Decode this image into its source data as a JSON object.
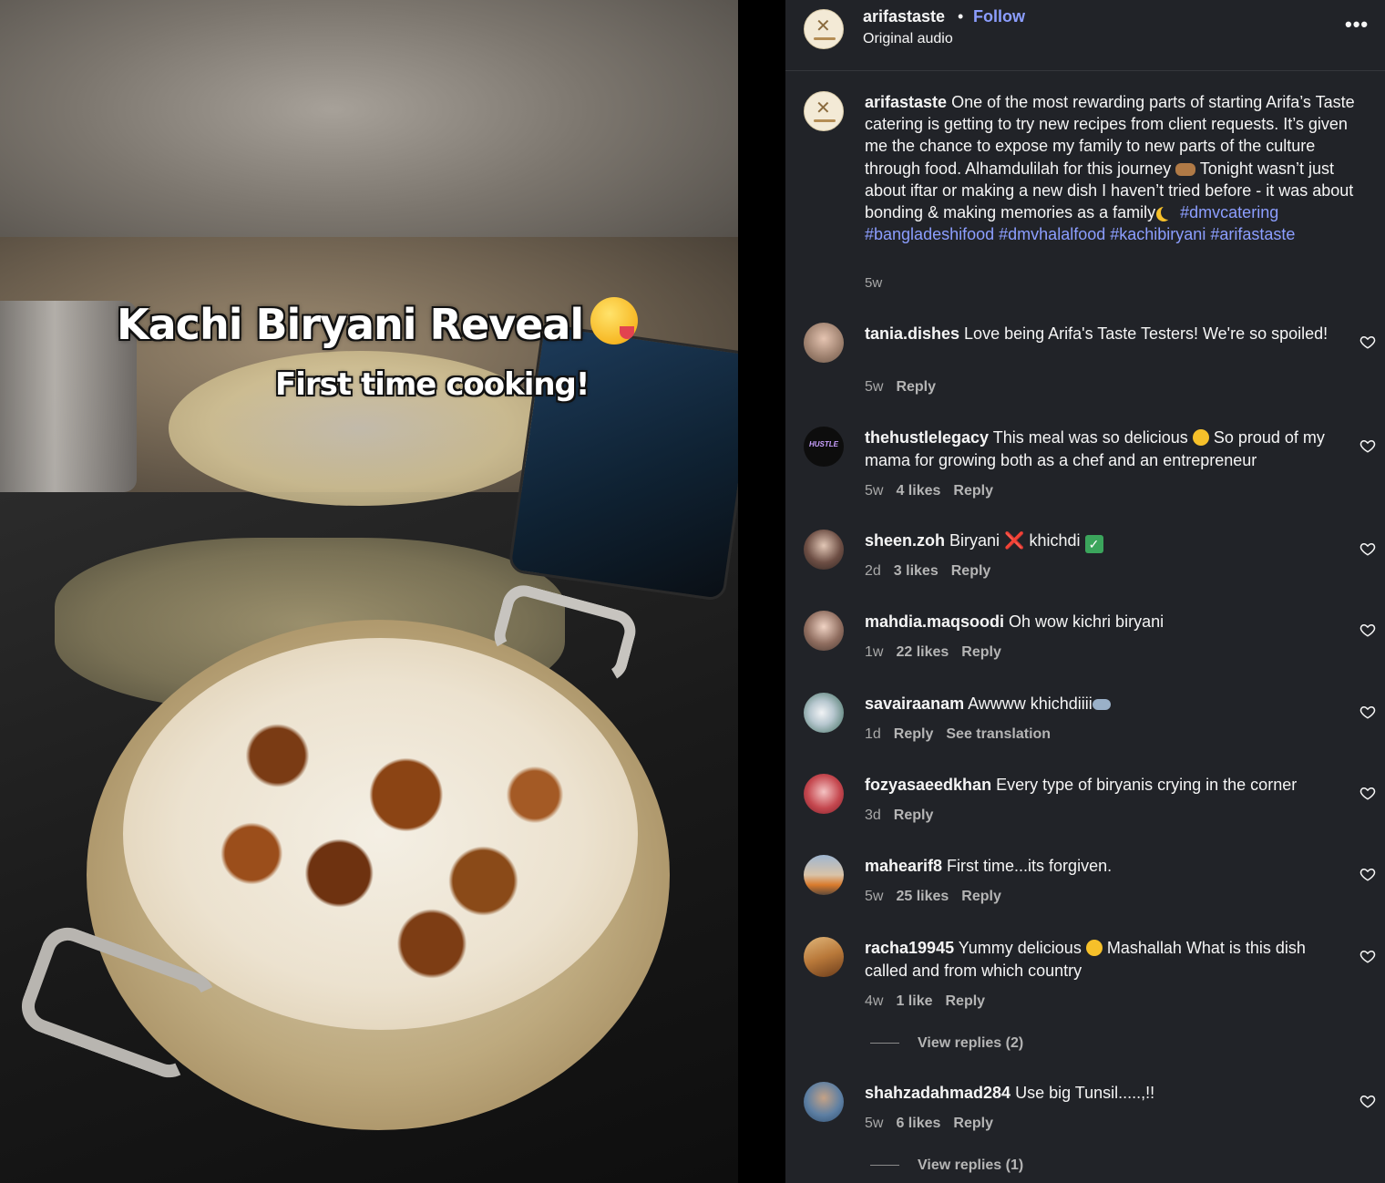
{
  "video": {
    "overlay_title": "Kachi Biryani Reveal",
    "overlay_subtitle": "First time cooking!",
    "overlay_emoji": "savoring-food-emoji"
  },
  "header": {
    "username": "arifastaste",
    "separator": "•",
    "follow_label": "Follow",
    "audio_label": "Original audio",
    "more_icon": "ellipsis-icon",
    "more_label": "•••"
  },
  "post": {
    "username": "arifastaste",
    "text_part1": " One of the most rewarding parts of starting Arifa’s Taste catering is getting to try new recipes from client requests. It’s given me the chance to expose my family to new parts of the culture through food. Alhamdulilah for this journey ",
    "text_part2": " Tonight wasn’t just about iftar or making a new dish I haven’t tried before - it was about bonding & making memories as a family",
    "hashtags": [
      "#dmvcatering",
      "#bangladeshifood",
      "#dmvhalalfood",
      "#kachibiryani",
      "#arifastaste"
    ],
    "age": "5w"
  },
  "comments": [
    {
      "username": "tania.dishes",
      "text": " Love being Arifa's Taste Testers! We're so spoiled!",
      "age": "5w",
      "likes": "",
      "reply_label": "Reply"
    },
    {
      "username": "thehustlelegacy",
      "text_a": " This meal was so delicious ",
      "text_b": " So proud of my mama for growing both as a chef and an entrepreneur",
      "age": "5w",
      "likes": "4 likes",
      "reply_label": "Reply",
      "avatar_text": "HUSTLE"
    },
    {
      "username": "sheen.zoh",
      "text_a": " Biryani ",
      "x_mark": "❌",
      "text_b": " khichdi ",
      "check_mark": "✓",
      "age": "2d",
      "likes": "3 likes",
      "reply_label": "Reply"
    },
    {
      "username": "mahdia.maqsoodi",
      "text": " Oh wow kichri biryani",
      "age": "1w",
      "likes": "22 likes",
      "reply_label": "Reply"
    },
    {
      "username": "savairaanam",
      "text": " Awwww khichdiiii",
      "age": "1d",
      "likes": "",
      "reply_label": "Reply",
      "translate_label": "See translation"
    },
    {
      "username": "fozyasaeedkhan",
      "text": " Every type of biryanis crying in the corner",
      "age": "3d",
      "likes": "",
      "reply_label": "Reply"
    },
    {
      "username": "mahearif8",
      "text": " First time...its forgiven.",
      "age": "5w",
      "likes": "25 likes",
      "reply_label": "Reply"
    },
    {
      "username": "racha19945",
      "text_a": " Yummy delicious ",
      "text_b": " Mashallah What is this dish called and from which country",
      "age": "4w",
      "likes": "1 like",
      "reply_label": "Reply",
      "view_replies": "View replies (2)"
    },
    {
      "username": "shahzadahmad284",
      "text": " Use big Tunsil.....,!!",
      "age": "5w",
      "likes": "6 likes",
      "reply_label": "Reply",
      "view_replies": "View replies (1)"
    }
  ],
  "colors": {
    "panel_bg": "#212328",
    "link_blue": "#8c9eff",
    "muted_text": "#a8a8a8"
  }
}
